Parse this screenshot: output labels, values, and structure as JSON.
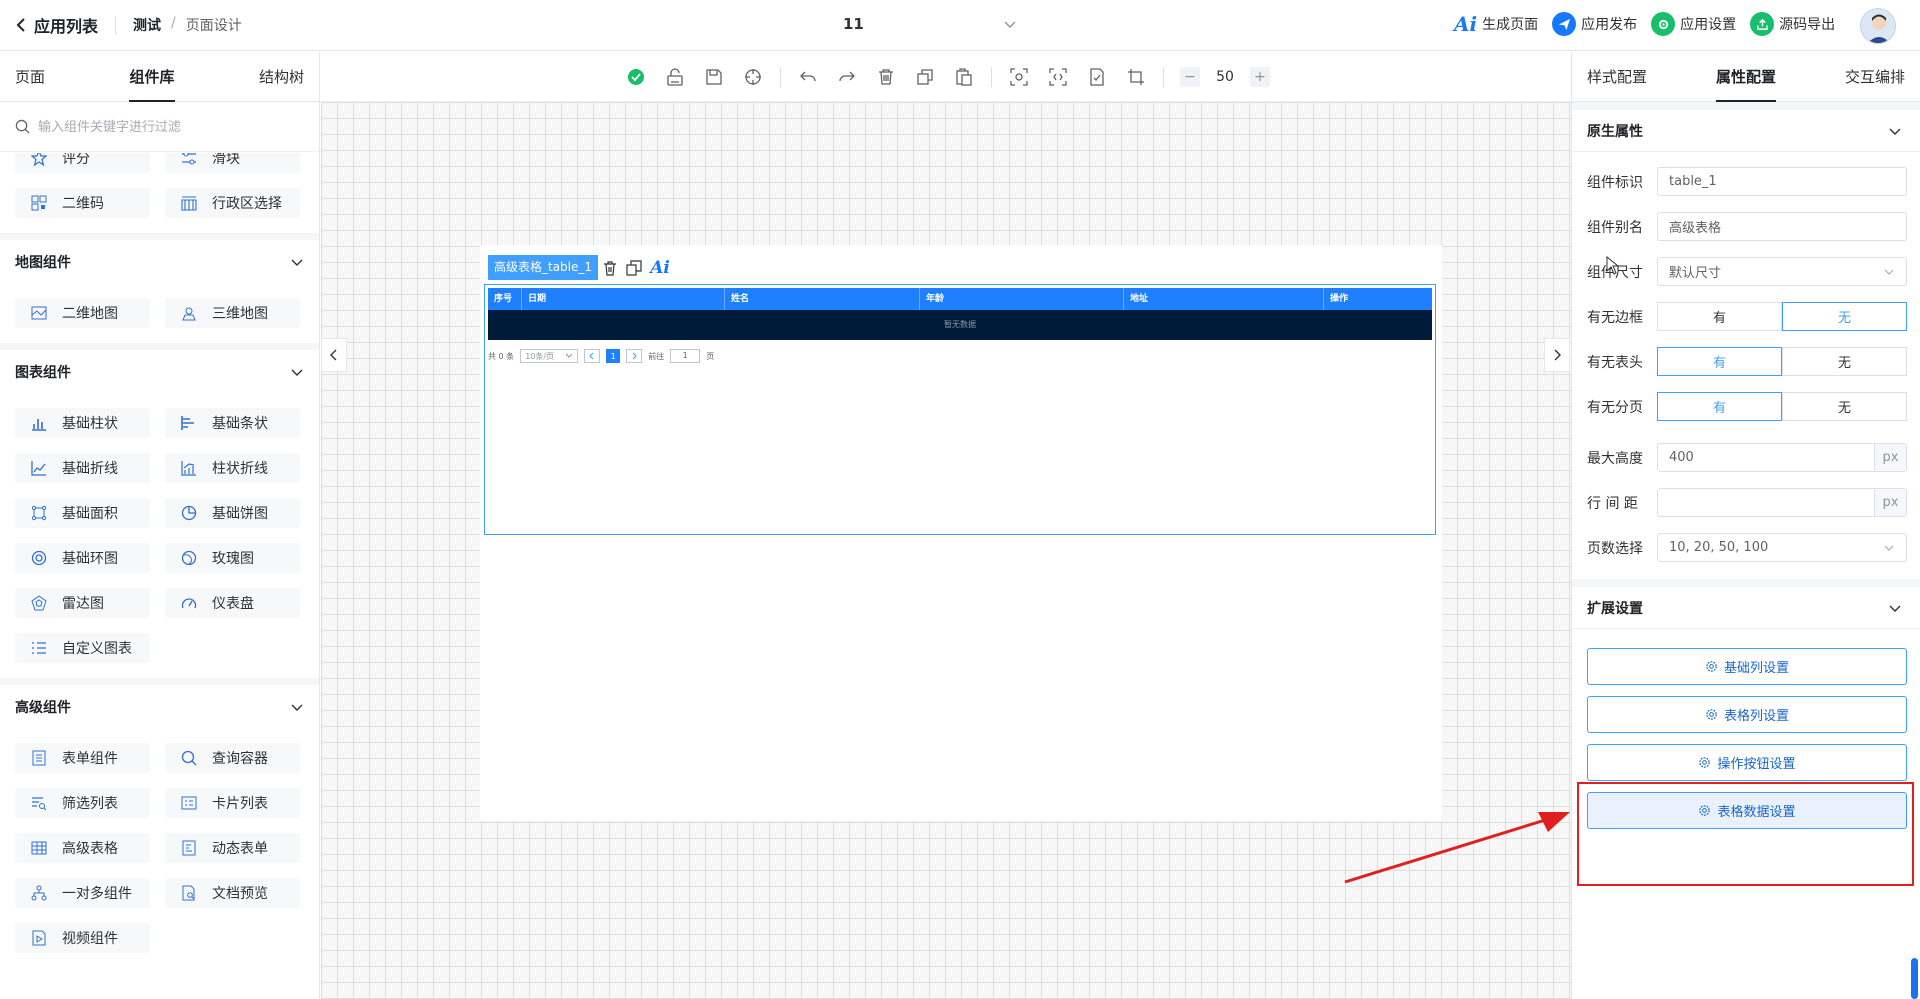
{
  "topbar": {
    "back_label": "应用列表",
    "breadcrumb_app": "测试",
    "breadcrumb_sep": "/",
    "breadcrumb_page": "页面设计",
    "page_selector_value": "11",
    "actions": [
      {
        "label": "生成页面",
        "icon": "ai-icon",
        "color": "#1677ff"
      },
      {
        "label": "应用发布",
        "icon": "send-icon",
        "color": "#1677ff"
      },
      {
        "label": "应用设置",
        "icon": "settings-icon",
        "color": "#19be6b"
      },
      {
        "label": "源码导出",
        "icon": "export-icon",
        "color": "#19be6b"
      }
    ],
    "ai_text": "Ai"
  },
  "left": {
    "tabs": [
      "页面",
      "组件库",
      "结构树"
    ],
    "active_tab": "组件库",
    "search_placeholder": "输入组件关键字进行过滤",
    "top_items": [
      {
        "label": "评分",
        "icon": "star-icon"
      },
      {
        "label": "滑块",
        "icon": "slider-icon"
      },
      {
        "label": "二维码",
        "icon": "qrcode-icon"
      },
      {
        "label": "行政区选择",
        "icon": "region-icon"
      }
    ],
    "groups": [
      {
        "title": "地图组件",
        "items": [
          {
            "label": "二维地图",
            "icon": "map-2d-icon"
          },
          {
            "label": "三维地图",
            "icon": "map-3d-icon"
          }
        ]
      },
      {
        "title": "图表组件",
        "items": [
          {
            "label": "基础柱状",
            "icon": "bar-chart-icon"
          },
          {
            "label": "基础条状",
            "icon": "hbar-chart-icon"
          },
          {
            "label": "基础折线",
            "icon": "line-chart-icon"
          },
          {
            "label": "柱状折线",
            "icon": "bar-line-chart-icon"
          },
          {
            "label": "基础面积",
            "icon": "area-chart-icon"
          },
          {
            "label": "基础饼图",
            "icon": "pie-chart-icon"
          },
          {
            "label": "基础环图",
            "icon": "ring-chart-icon"
          },
          {
            "label": "玫瑰图",
            "icon": "rose-chart-icon"
          },
          {
            "label": "雷达图",
            "icon": "radar-chart-icon"
          },
          {
            "label": "仪表盘",
            "icon": "gauge-icon"
          },
          {
            "label": "自定义图表",
            "icon": "custom-chart-icon"
          }
        ]
      },
      {
        "title": "高级组件",
        "items": [
          {
            "label": "表单组件",
            "icon": "form-icon"
          },
          {
            "label": "查询容器",
            "icon": "search-icon"
          },
          {
            "label": "筛选列表",
            "icon": "filter-list-icon"
          },
          {
            "label": "卡片列表",
            "icon": "card-list-icon"
          },
          {
            "label": "高级表格",
            "icon": "table-icon"
          },
          {
            "label": "动态表单",
            "icon": "dynamic-form-icon"
          },
          {
            "label": "一对多组件",
            "icon": "one-to-many-icon"
          },
          {
            "label": "文档预览",
            "icon": "doc-preview-icon"
          },
          {
            "label": "视频组件",
            "icon": "video-icon"
          }
        ]
      }
    ]
  },
  "toolbar": {
    "zoom_value": "50",
    "zoom_minus": "−",
    "zoom_plus": "+"
  },
  "canvas": {
    "selected_label": "高级表格_table_1",
    "ai_text": "Ai",
    "table": {
      "headers": [
        "序号",
        "日期",
        "姓名",
        "年龄",
        "地址",
        "操作"
      ],
      "empty_text": "暂无数据",
      "pager_total": "共 0 条",
      "pager_size": "10条/页",
      "pager_page": "1",
      "pager_goto": "前往",
      "pager_goto_value": "1",
      "pager_page_unit": "页"
    }
  },
  "right": {
    "tabs": [
      "样式配置",
      "属性配置",
      "交互编排"
    ],
    "active_tab": "属性配置",
    "section_native": "原生属性",
    "section_extend": "扩展设置",
    "props": {
      "id_label": "组件标识",
      "id_value": "table_1",
      "alias_label": "组件别名",
      "alias_value": "高级表格",
      "size_label": "组件尺寸",
      "size_value": "默认尺寸",
      "border_label": "有无边框",
      "header_label": "有无表头",
      "paging_label": "有无分页",
      "yes": "有",
      "no": "无",
      "maxh_label": "最大高度",
      "maxh_value": "400",
      "maxh_unit": "px",
      "rowgap_label": "行 间 距",
      "rowgap_value": "",
      "rowgap_unit": "px",
      "pagesizes_label": "页数选择",
      "pagesizes_value": "10, 20, 50, 100"
    },
    "buttons": [
      "基础列设置",
      "表格列设置",
      "操作按钮设置",
      "表格数据设置"
    ]
  }
}
